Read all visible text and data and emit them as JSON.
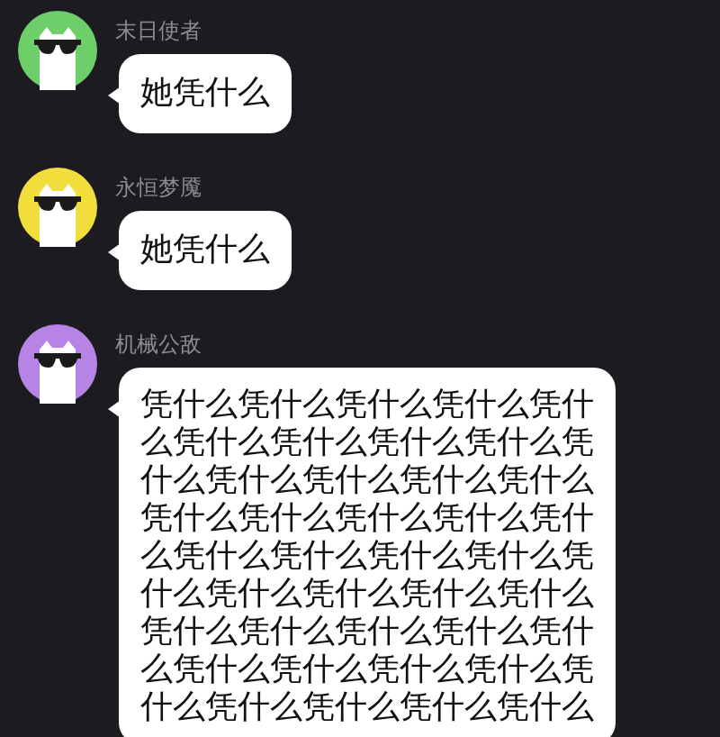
{
  "messages": [
    {
      "sender": "末日使者",
      "color": "#6dcf6a",
      "text": "她凭什么"
    },
    {
      "sender": "永恒梦魇",
      "color": "#f1de3c",
      "text": "她凭什么"
    },
    {
      "sender": "机械公敌",
      "color": "#b883e6",
      "text": "凭什么凭什么凭什么凭什么凭什么凭什么凭什么凭什么凭什么凭什么凭什么凭什么凭什么凭什么凭什么凭什么凭什么凭什么凭什么凭什么凭什么凭什么凭什么凭什么凭什么凭什么凭什么凭什么凭什么凭什么凭什么凭什么凭什么凭什么凭什么凭什么凭什么凭什么凭什么凭什么凭什么凭什么"
    }
  ]
}
